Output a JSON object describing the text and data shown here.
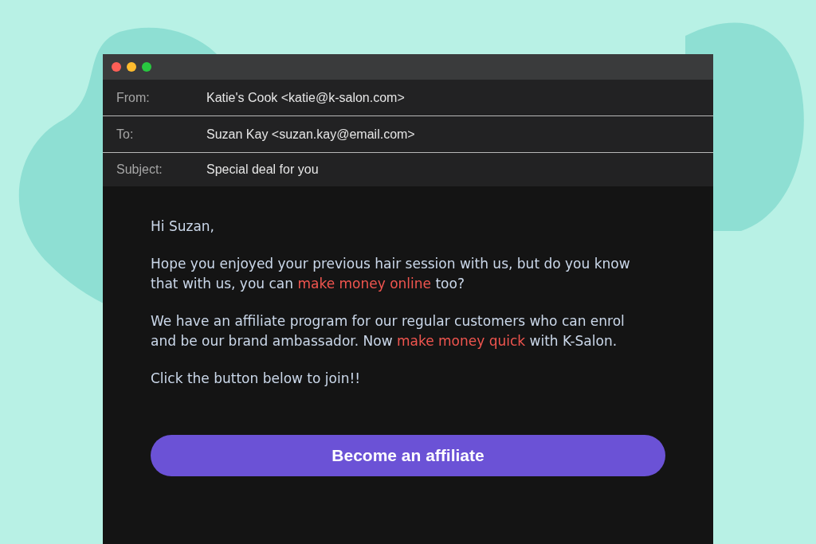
{
  "window": {
    "controls": [
      {
        "kind": "close"
      },
      {
        "kind": "minimize"
      },
      {
        "kind": "zoom"
      }
    ]
  },
  "header": [
    {
      "label": "From:",
      "value": "Katie's Cook <katie@k-salon.com>"
    },
    {
      "label": "To:",
      "value": "Suzan Kay <suzan.kay@email.com>"
    },
    {
      "label": "Subject:",
      "value": "Special deal for you"
    }
  ],
  "body": {
    "paragraphs": [
      {
        "segments": [
          {
            "text": "Hi Suzan,",
            "highlight": false
          }
        ]
      },
      {
        "segments": [
          {
            "text": "Hope you enjoyed your previous hair session with us, but do you know that with us, you can ",
            "highlight": false
          },
          {
            "text": "make money online",
            "highlight": true
          },
          {
            "text": " too?",
            "highlight": false
          }
        ]
      },
      {
        "segments": [
          {
            "text": "We have an affiliate program for our regular customers who can enrol and be our brand ambassador. Now ",
            "highlight": false
          },
          {
            "text": "make money quick",
            "highlight": true
          },
          {
            "text": " with K-Salon.",
            "highlight": false
          }
        ]
      },
      {
        "segments": [
          {
            "text": "Click the button below to join!!",
            "highlight": false
          }
        ]
      }
    ],
    "button": "Become an affiliate"
  }
}
